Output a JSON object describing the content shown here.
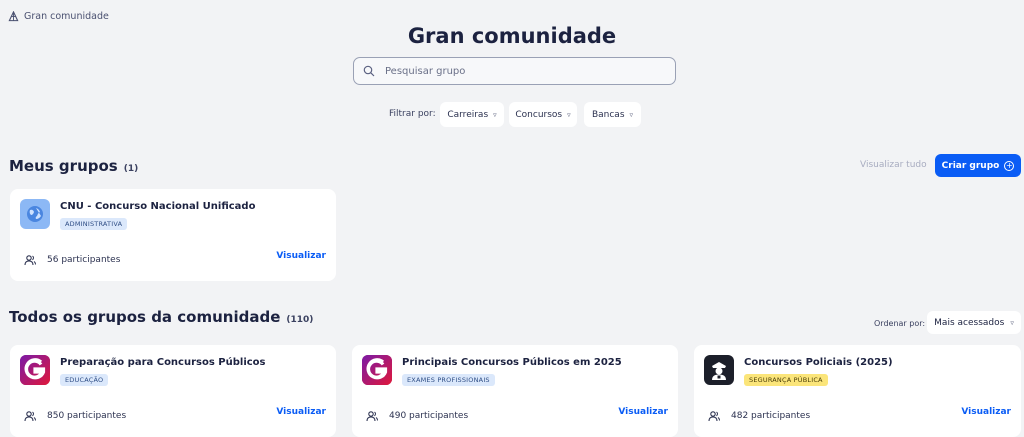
{
  "breadcrumb": {
    "label": "Gran comunidade"
  },
  "page": {
    "title": "Gran comunidade"
  },
  "search": {
    "placeholder": "Pesquisar grupo"
  },
  "filters": {
    "label": "Filtrar por:",
    "options": [
      {
        "label": "Carreiras"
      },
      {
        "label": "Concursos"
      },
      {
        "label": "Bancas"
      }
    ]
  },
  "my_groups": {
    "title": "Meus grupos",
    "count": "(1)",
    "see_all_label": "Visualizar tudo",
    "create_label": "Criar grupo",
    "cards": [
      {
        "name": "CNU - Concurso Nacional Unificado",
        "tag": "ADMINISTRATIVA",
        "participants": "56 participantes",
        "view_label": "Visualizar",
        "logo_icon": "globe-icon"
      }
    ]
  },
  "all_groups": {
    "title": "Todos os grupos da comunidade",
    "count": "(110)",
    "order_label": "Ordenar por:",
    "order_value": "Mais acessados",
    "cards": [
      {
        "name": "Preparação para Concursos Públicos",
        "tag": "EDUCAÇÃO",
        "participants": "850 participantes",
        "view_label": "Visualizar",
        "logo_icon": "gran-logo-icon"
      },
      {
        "name": "Principais Concursos Públicos em 2025",
        "tag": "EXAMES PROFISSIONAIS",
        "participants": "490 participantes",
        "view_label": "Visualizar",
        "logo_icon": "gran-logo-icon"
      },
      {
        "name": "Concursos Policiais (2025)",
        "tag": "SEGURANÇA PÚBLICA",
        "participants": "482 participantes",
        "view_label": "Visualizar",
        "logo_icon": "police-officer-icon"
      }
    ]
  },
  "colors": {
    "primary": "#0a5cf5",
    "background": "#f2f3f5",
    "tag_blue": "#dbe8fb",
    "tag_yellow": "#fbe57a"
  }
}
